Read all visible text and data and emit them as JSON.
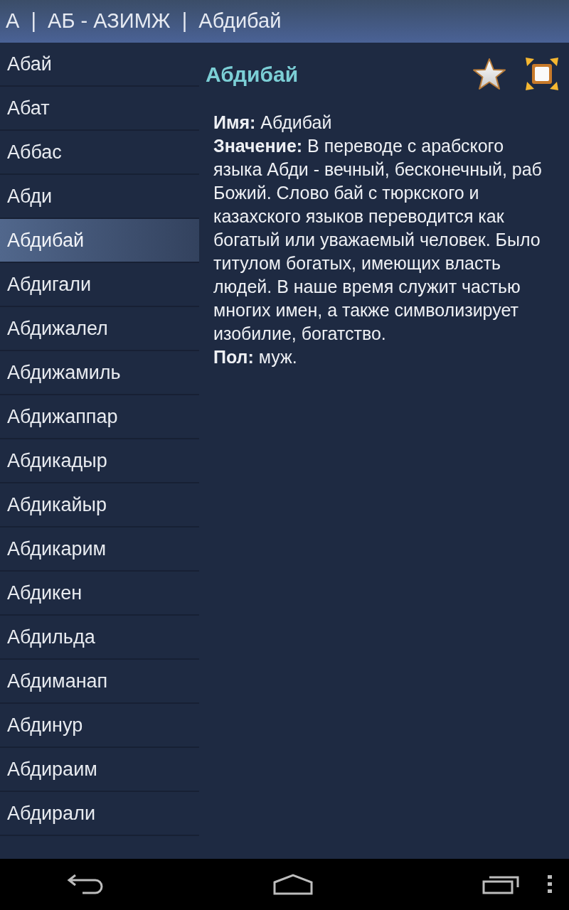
{
  "title_bar": {
    "title": "А  |  АБ - АЗИМЖ  |  Абдибай"
  },
  "name_list": [
    {
      "name": "Абай",
      "selected": false
    },
    {
      "name": "Абат",
      "selected": false
    },
    {
      "name": "Аббас",
      "selected": false
    },
    {
      "name": "Абди",
      "selected": false
    },
    {
      "name": "Абдибай",
      "selected": true
    },
    {
      "name": "Абдигали",
      "selected": false
    },
    {
      "name": "Абдижалел",
      "selected": false
    },
    {
      "name": "Абдижамиль",
      "selected": false
    },
    {
      "name": "Абдижаппар",
      "selected": false
    },
    {
      "name": "Абдикадыр",
      "selected": false
    },
    {
      "name": "Абдикайыр",
      "selected": false
    },
    {
      "name": "Абдикарим",
      "selected": false
    },
    {
      "name": "Абдикен",
      "selected": false
    },
    {
      "name": "Абдильда",
      "selected": false
    },
    {
      "name": "Абдиманап",
      "selected": false
    },
    {
      "name": "Абдинур",
      "selected": false
    },
    {
      "name": "Абдираим",
      "selected": false
    },
    {
      "name": "Абдирали",
      "selected": false
    }
  ],
  "detail": {
    "heading": "Абдибай",
    "lines": [
      "**Имя:** Абдибай",
      "**Значение:** В переводе с арабского языка Абди - вечный, бесконечный, раб Божий. Слово бай с тюркского и казахского языков переводится как богатый или уважаемый человек. Было титулом богатых, имеющих власть людей. В наше время служит частью многих имен, а также символизирует изобилие, богатство.",
      "**Пол:** муж."
    ]
  }
}
